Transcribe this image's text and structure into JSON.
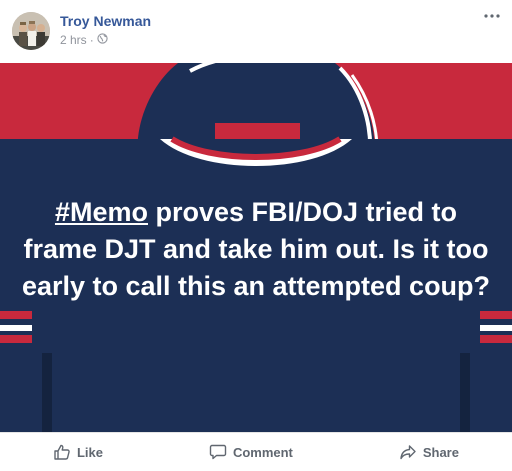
{
  "post": {
    "author": "Troy Newman",
    "time": "2 hrs",
    "privacy_icon": "globe-icon",
    "more_icon": "more-options-icon",
    "hashtag": "#Memo",
    "text_rest": " proves FBI/DOJ tried to frame DJT and take him out. Is it too early to call this an attempted coup?"
  },
  "actions": {
    "like": "Like",
    "comment": "Comment",
    "share": "Share"
  },
  "colors": {
    "background_red": "#c8293d",
    "jersey_navy": "#1c2f55",
    "link_blue": "#365899",
    "meta_gray": "#90949c"
  }
}
